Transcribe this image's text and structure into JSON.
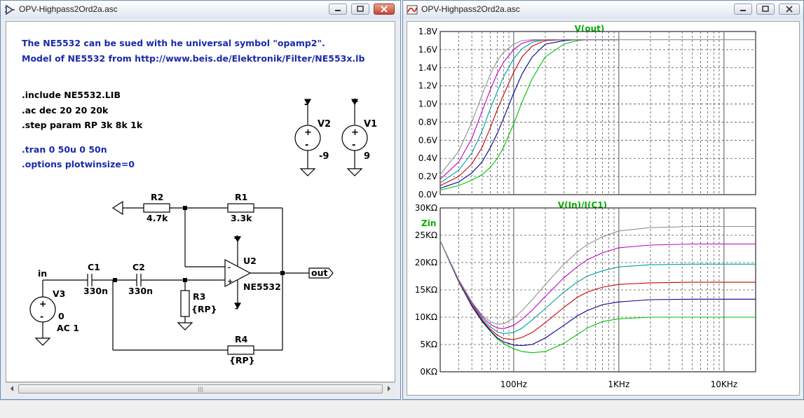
{
  "schematic_window": {
    "title": "OPV-Highpass2Ord2a.asc",
    "comment_line1": "The NE5532 can be sued with he universal symbol \"opamp2\".",
    "comment_line2": "Model of NE5532 from http://www.beis.de/Elektronik/Filter/NE553x.lb",
    "directives": [
      ".include  NE5532.LIB",
      ".ac dec 20 20 20k",
      ".step param RP 3k 8k 1k"
    ],
    "commented_directives": [
      ".tran 0 50u 0 50n",
      ".options plotwinsize=0"
    ],
    "components": {
      "V2": {
        "name": "V2",
        "value": "-9",
        "sign": "-"
      },
      "V1": {
        "name": "V1",
        "value": "9",
        "sign": "+"
      },
      "R2": {
        "name": "R2",
        "value": "4.7k"
      },
      "R1": {
        "name": "R1",
        "value": "3.3k"
      },
      "U2": {
        "name": "U2",
        "value": "NE5532",
        "plus": "+",
        "minus": "-"
      },
      "C1": {
        "name": "C1",
        "value": "330n"
      },
      "C2": {
        "name": "C2",
        "value": "330n"
      },
      "R3": {
        "name": "R3",
        "value": "{RP}"
      },
      "R4": {
        "name": "R4",
        "value": "{RP}"
      },
      "V3": {
        "name": "V3",
        "value": "0",
        "ac": "AC 1"
      }
    },
    "net_in": "in",
    "net_out": "out",
    "scroll_grip": "|||"
  },
  "plot_window": {
    "title": "OPV-Highpass2Ord2a.asc",
    "top_trace_label": "V(out)",
    "bottom_trace_label": "V(In)/I(C1)",
    "bottom_left_label": "Zin",
    "x_tick_labels": [
      "100Hz",
      "1KHz",
      "10KHz"
    ],
    "top_y_ticks": [
      "1.8V",
      "1.6V",
      "1.4V",
      "1.2V",
      "1.0V",
      "0.8V",
      "0.6V",
      "0.4V",
      "0.2V",
      "0.0V"
    ],
    "bottom_y_ticks": [
      "30KΩ",
      "25KΩ",
      "20KΩ",
      "15KΩ",
      "10KΩ",
      "5KΩ",
      "0KΩ"
    ]
  },
  "colors": {
    "series": [
      "#00c000",
      "#000090",
      "#cc0000",
      "#00a0a0",
      "#c000c0",
      "#909090"
    ],
    "comment_text": "#1a2aa8",
    "trace_label": "#00b000"
  },
  "chart_data": [
    {
      "type": "line",
      "title": "V(out)",
      "xscale": "log",
      "xlim": [
        20,
        20000
      ],
      "ylim": [
        0,
        1.8
      ],
      "x": [
        20,
        30,
        40,
        50,
        60,
        70,
        80,
        100,
        120,
        150,
        200,
        300,
        400,
        500,
        700,
        1000
      ],
      "series": [
        {
          "values": [
            0.05,
            0.1,
            0.16,
            0.22,
            0.3,
            0.4,
            0.52,
            0.78,
            1.02,
            1.28,
            1.52,
            1.66,
            1.7,
            1.71,
            1.71,
            1.71
          ]
        },
        {
          "values": [
            0.07,
            0.14,
            0.24,
            0.36,
            0.52,
            0.68,
            0.84,
            1.12,
            1.33,
            1.52,
            1.66,
            1.7,
            1.71,
            1.71,
            1.71,
            1.71
          ]
        },
        {
          "values": [
            0.1,
            0.2,
            0.34,
            0.52,
            0.74,
            0.94,
            1.1,
            1.35,
            1.52,
            1.64,
            1.7,
            1.71,
            1.71,
            1.71,
            1.71,
            1.71
          ]
        },
        {
          "values": [
            0.13,
            0.27,
            0.46,
            0.7,
            0.95,
            1.14,
            1.3,
            1.5,
            1.61,
            1.68,
            1.71,
            1.71,
            1.71,
            1.71,
            1.71,
            1.71
          ]
        },
        {
          "values": [
            0.17,
            0.36,
            0.62,
            0.92,
            1.16,
            1.34,
            1.46,
            1.6,
            1.67,
            1.7,
            1.71,
            1.71,
            1.71,
            1.71,
            1.71,
            1.71
          ]
        },
        {
          "values": [
            0.22,
            0.48,
            0.8,
            1.1,
            1.33,
            1.48,
            1.57,
            1.66,
            1.7,
            1.71,
            1.71,
            1.71,
            1.71,
            1.71,
            1.71,
            1.71
          ]
        }
      ]
    },
    {
      "type": "line",
      "title": "V(In)/I(C1)",
      "xscale": "log",
      "xlim": [
        20,
        20000
      ],
      "ylim": [
        0,
        30000
      ],
      "x": [
        20,
        30,
        40,
        50,
        60,
        70,
        80,
        100,
        120,
        150,
        200,
        300,
        400,
        500,
        700,
        1000,
        2000,
        5000,
        10000,
        20000
      ],
      "series": [
        {
          "values": [
            24000,
            16500,
            12000,
            9200,
            7400,
            6000,
            5200,
            4200,
            3700,
            3500,
            3700,
            5200,
            6800,
            8000,
            9200,
            9700,
            10000,
            10000,
            10000,
            10000
          ]
        },
        {
          "values": [
            24000,
            16500,
            12000,
            9300,
            7500,
            6200,
            5500,
            4900,
            4800,
            5000,
            6200,
            8500,
            10200,
            11200,
            12300,
            12800,
            13200,
            13300,
            13300,
            13300
          ]
        },
        {
          "values": [
            24000,
            16600,
            12200,
            9500,
            7800,
            6700,
            6100,
            5900,
            6300,
            7200,
            9000,
            11800,
            13600,
            14600,
            15500,
            16000,
            16300,
            16400,
            16400,
            16400
          ]
        },
        {
          "values": [
            24000,
            16700,
            12400,
            9800,
            8200,
            7300,
            7000,
            7200,
            8000,
            9500,
            11600,
            14600,
            16400,
            17500,
            18500,
            19200,
            19600,
            19700,
            19700,
            19700
          ]
        },
        {
          "values": [
            24000,
            16800,
            12600,
            10100,
            8700,
            8000,
            7900,
            8500,
            9600,
            11300,
            13800,
            17200,
            19200,
            20500,
            21800,
            22700,
            23200,
            23400,
            23400,
            23400
          ]
        },
        {
          "values": [
            24000,
            16900,
            12800,
            10400,
            9200,
            8700,
            8800,
            9800,
            11200,
            13200,
            16000,
            19700,
            21900,
            23300,
            24700,
            25800,
            26400,
            26600,
            26600,
            26600
          ]
        }
      ]
    }
  ]
}
